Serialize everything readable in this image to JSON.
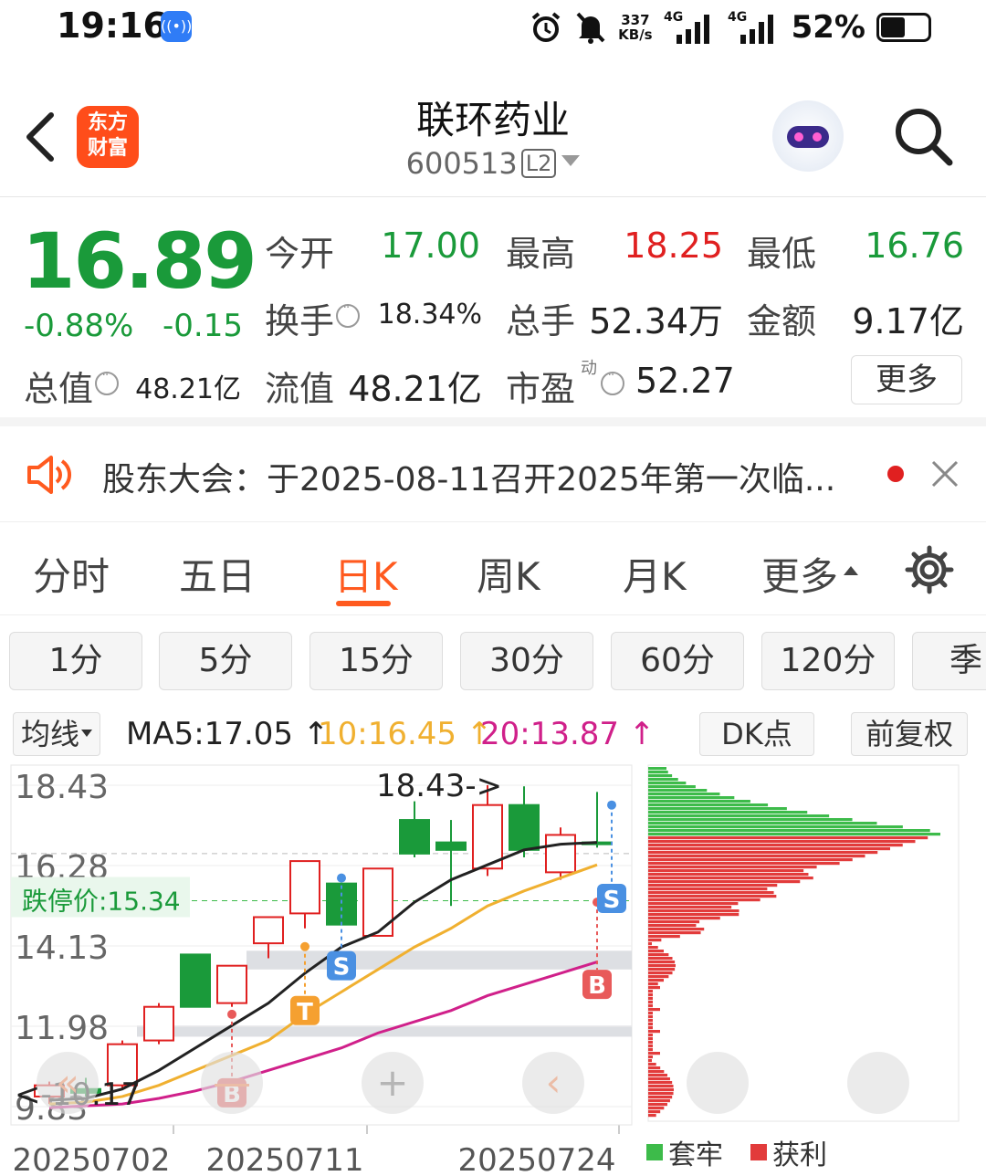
{
  "status_bar": {
    "time": "19:16",
    "hotspot_icon": "hotspot-icon",
    "speed_value": "337",
    "speed_unit": "KB/s",
    "net1": "4G",
    "net2": "4G",
    "battery": "52%"
  },
  "header": {
    "app_logo": "东方\n财富",
    "logo_line1": "东方",
    "logo_line2": "财富",
    "stock_name": "联环药业",
    "stock_code": "600513",
    "level_badge": "L2"
  },
  "quote": {
    "price": "16.89",
    "change_pct": "-0.88%",
    "change_abs": "-0.15",
    "open_label": "今开",
    "open": "17.00",
    "high_label": "最高",
    "high": "18.25",
    "low_label": "最低",
    "low": "16.76",
    "turnover_label": "换手",
    "turnover": "18.34%",
    "volume_label": "总手",
    "volume": "52.34万",
    "amount_label": "金额",
    "amount": "9.17亿",
    "mktcap_label": "总值",
    "mktcap": "48.21亿",
    "float_label": "流值",
    "float_cap": "48.21亿",
    "pe_label": "市盈",
    "pe_sup": "动",
    "pe": "52.27",
    "more_label": "更多"
  },
  "notice": {
    "text": "股东大会：于2025-08-11召开2025年第一次临..."
  },
  "period_tabs": [
    {
      "label": "分时"
    },
    {
      "label": "五日"
    },
    {
      "label": "日K"
    },
    {
      "label": "周K"
    },
    {
      "label": "月K"
    },
    {
      "label": "更多"
    }
  ],
  "active_tab": "日K",
  "minute_chips": [
    "1分",
    "5分",
    "15分",
    "30分",
    "60分",
    "120分",
    "季"
  ],
  "indicator": {
    "select_label": "均线",
    "ma5": "MA5:17.05 ↑",
    "ma10": "10:16.45 ↑",
    "ma20": "20:13.87 ↑",
    "dk_label": "DK点",
    "adjust_label": "前复权"
  },
  "colors": {
    "up": "#e02020",
    "down": "#1a9a3a",
    "accent": "#ff5a1f",
    "ma5": "#222222",
    "ma10": "#f0b030",
    "ma20": "#d0208a"
  },
  "legend": {
    "trapped": "套牢",
    "profit": "获利"
  },
  "chart_data": {
    "type": "candlestick",
    "y_ticks": [
      "18.43",
      "16.28",
      "14.13",
      "11.98",
      "9.83"
    ],
    "x_ticks": [
      "20250702",
      "20250711",
      "20250724"
    ],
    "ylim": [
      9.83,
      18.43
    ],
    "limit_down_label": "跌停价:15.34",
    "limit_down": 15.34,
    "current_price": 16.89,
    "max_label": "18.43->",
    "min_label": "<-10.17",
    "candles": [
      {
        "o": 10.1,
        "h": 10.5,
        "l": 9.9,
        "c": 10.4
      },
      {
        "o": 10.3,
        "h": 10.6,
        "l": 10.1,
        "c": 10.2
      },
      {
        "o": 10.4,
        "h": 11.6,
        "l": 10.3,
        "c": 11.5
      },
      {
        "o": 11.6,
        "h": 12.6,
        "l": 11.5,
        "c": 12.5
      },
      {
        "o": 13.9,
        "h": 13.9,
        "l": 12.5,
        "c": 12.5
      },
      {
        "o": 12.6,
        "h": 13.6,
        "l": 12.5,
        "c": 13.6
      },
      {
        "o": 14.2,
        "h": 14.9,
        "l": 13.8,
        "c": 14.9
      },
      {
        "o": 15.0,
        "h": 16.4,
        "l": 14.6,
        "c": 16.4
      },
      {
        "o": 15.8,
        "h": 15.8,
        "l": 14.7,
        "c": 14.7
      },
      {
        "o": 14.4,
        "h": 16.2,
        "l": 14.4,
        "c": 16.2
      },
      {
        "o": 17.5,
        "h": 18.0,
        "l": 16.5,
        "c": 16.6
      },
      {
        "o": 16.9,
        "h": 17.5,
        "l": 15.2,
        "c": 16.7
      },
      {
        "o": 16.2,
        "h": 18.43,
        "l": 16.0,
        "c": 17.9
      },
      {
        "o": 17.9,
        "h": 18.4,
        "l": 16.5,
        "c": 16.7
      },
      {
        "o": 16.1,
        "h": 17.3,
        "l": 15.9,
        "c": 17.1
      },
      {
        "o": 16.9,
        "h": 18.25,
        "l": 16.76,
        "c": 16.89
      }
    ],
    "ma5": [
      10.0,
      10.05,
      10.3,
      10.8,
      11.4,
      12.0,
      12.6,
      13.4,
      14.1,
      14.5,
      15.3,
      15.9,
      16.3,
      16.7,
      16.85,
      16.9
    ],
    "ma10": [
      9.9,
      9.95,
      10.1,
      10.4,
      10.8,
      11.2,
      11.6,
      12.3,
      12.9,
      13.5,
      14.1,
      14.6,
      15.2,
      15.6,
      15.95,
      16.3
    ],
    "ma20": [
      9.8,
      9.85,
      9.9,
      10.05,
      10.25,
      10.5,
      10.8,
      11.1,
      11.4,
      11.8,
      12.1,
      12.4,
      12.8,
      13.1,
      13.4,
      13.7
    ],
    "signals": [
      {
        "idx": 5,
        "label": "B",
        "kind": "buy"
      },
      {
        "idx": 7,
        "label": "T",
        "kind": "t"
      },
      {
        "idx": 8,
        "label": "S",
        "kind": "sell"
      },
      {
        "idx": 15,
        "label": "B",
        "kind": "buy"
      },
      {
        "idx": 16,
        "label": "S",
        "kind": "sell"
      }
    ],
    "resistance_bands": [
      {
        "y1": 14.0,
        "y2": 13.5
      },
      {
        "y1": 12.0,
        "y2": 11.7
      }
    ]
  }
}
